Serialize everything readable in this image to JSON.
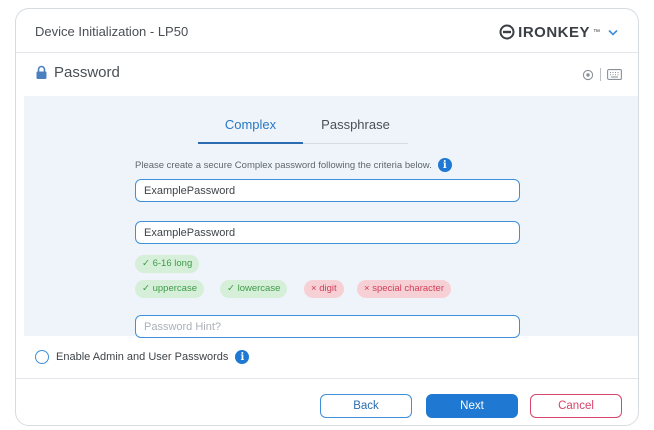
{
  "window": {
    "title": "Device Initialization - LP50",
    "brand": "IRONKEY",
    "brand_tm": "™"
  },
  "section": {
    "title": "Password",
    "icons": [
      "lock-icon",
      "eye-icon",
      "keyboard-icon"
    ]
  },
  "tabs": [
    {
      "label": "Complex",
      "active": true
    },
    {
      "label": "Passphrase",
      "active": false
    }
  ],
  "instructions": "Please create a secure Complex password following the criteria below.",
  "fields": {
    "password": "ExamplePassword",
    "confirm_password": "ExamplePassword",
    "hint_placeholder": "Password Hint?"
  },
  "criteria": [
    {
      "label": "6-16 long",
      "met": true
    },
    {
      "label": "uppercase",
      "met": true
    },
    {
      "label": "lowercase",
      "met": true
    },
    {
      "label": "digit",
      "met": false
    },
    {
      "label": "special character",
      "met": false
    }
  ],
  "admin_option": {
    "label": "Enable Admin and User Passwords",
    "checked": false
  },
  "buttons": {
    "back": "Back",
    "next": "Next",
    "cancel": "Cancel"
  },
  "colors": {
    "accent": "#1f78d1",
    "ok": "#3e9b4a",
    "bad": "#cf4058",
    "cancel": "#d5466a",
    "panel": "#eef4fa"
  }
}
